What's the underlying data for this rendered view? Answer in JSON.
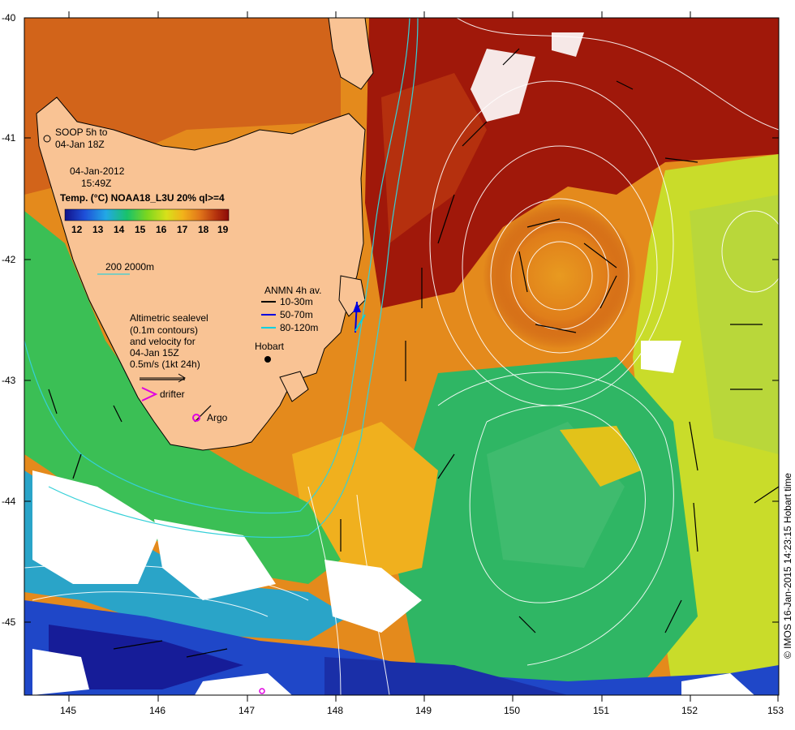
{
  "map": {
    "date": "04-Jan-2012",
    "time": "15:49Z",
    "sst_title": "Temp. (°C) NOAA18_L3U 20% ql>=4",
    "colorbar_ticks": [
      "12",
      "13",
      "14",
      "15",
      "16",
      "17",
      "18",
      "19"
    ],
    "colorbar_colors": [
      "#12128a",
      "#1e4fd8",
      "#22a8e6",
      "#19c26a",
      "#7bd61f",
      "#d8e01a",
      "#f2b21a",
      "#e2781a",
      "#b6340e",
      "#8b0a08"
    ],
    "soop_label_1": "SOOP 5h to",
    "soop_label_2": "04-Jan 18Z",
    "depth_contours": "200  2000m",
    "anmn_title": "ANMN 4h av.",
    "anmn_items": [
      {
        "label": "10-30m",
        "color": "#000000"
      },
      {
        "label": "50-70m",
        "color": "#0000e0"
      },
      {
        "label": "80-120m",
        "color": "#00d0e0"
      }
    ],
    "altimetry_lines": [
      "Altimetric sealevel",
      "(0.1m contours)",
      "and velocity for",
      "04-Jan 15Z",
      "0.5m/s (1kt 24h)"
    ],
    "drifter_label": "drifter",
    "argo_label": "Argo",
    "city": "Hobart",
    "credit": "© IMOS 16-Jan-2015 14:23:15 Hobart time",
    "lat_ticks": [
      "-40",
      "-41",
      "-42",
      "-43",
      "-44",
      "-45"
    ],
    "lon_ticks": [
      "145",
      "146",
      "147",
      "148",
      "149",
      "150",
      "151",
      "152",
      "153"
    ],
    "land_color": "#f9c394"
  }
}
